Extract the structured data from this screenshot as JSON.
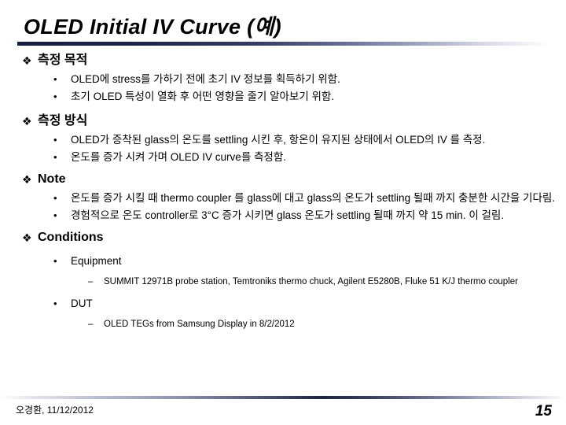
{
  "slide": {
    "title": "OLED Initial IV Curve (예)",
    "markers": {
      "level1": "❖",
      "level2": "•",
      "level3": "–"
    },
    "sections": [
      {
        "heading": "측정 목적",
        "bullets": [
          "OLED에 stress를 가하기 전에 초기 IV 정보를 획득하기 위함.",
          "초기 OLED 특성이 열화 후 어떤 영향을 줄기 알아보기 위함."
        ]
      },
      {
        "heading": "측정 방식",
        "bullets": [
          "OLED가 증착된 glass의 온도를 settling 시킨 후, 항온이 유지된 상태에서 OLED의 IV 를 측정.",
          "온도를 증가 시켜 가며 OLED IV curve를 측정함."
        ]
      },
      {
        "heading": "Note",
        "bullets": [
          "온도를 증가 시킬 때 thermo coupler 를 glass에 대고 glass의 온도가 settling 될때 까지 충분한 시간을 기다림.",
          "경험적으로 온도 controller로 3°C 증가 시키면 glass 온도가 settling 될때 까지 약 15 min. 이 걸림."
        ]
      },
      {
        "heading": "Conditions",
        "subitems": [
          {
            "label": "Equipment",
            "details": [
              "SUMMIT 12971B probe station, Temtroniks thermo chuck, Agilent E5280B, Fluke 51 K/J thermo coupler"
            ]
          },
          {
            "label": "DUT",
            "details": [
              "OLED TEGs from Samsung Display in 8/2/2012"
            ]
          }
        ]
      }
    ]
  },
  "footer": {
    "author_date": "오경환, 11/12/2012",
    "page_number": "15"
  },
  "colors": {
    "rule_dark": "#1d2546",
    "text": "#000000",
    "background": "#ffffff"
  }
}
